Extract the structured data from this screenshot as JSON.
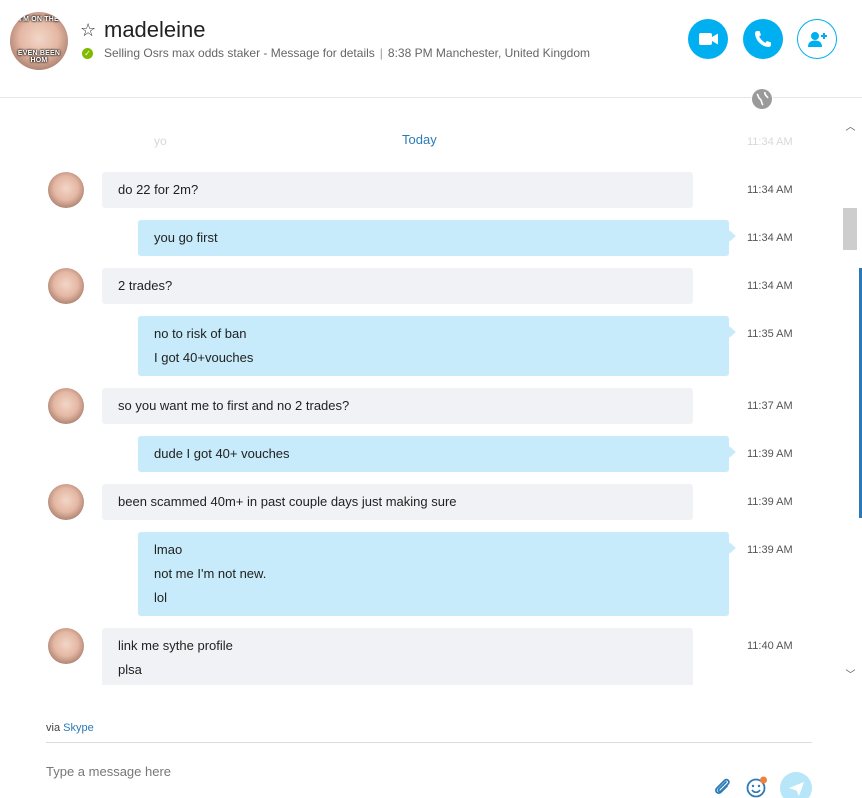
{
  "contact": {
    "name": "madeleine",
    "mood": "Selling Osrs max odds staker - Message for details",
    "local_time": "8:38 PM Manchester, United Kingdom",
    "avatar_caption_top": "I'M ON THE",
    "avatar_caption_bottom": "EVEN BEEN HOM"
  },
  "header": {
    "actions": [
      {
        "name": "video-call",
        "icon": "video-icon"
      },
      {
        "name": "audio-call",
        "icon": "phone-icon"
      },
      {
        "name": "add-people",
        "icon": "add-person-icon"
      }
    ]
  },
  "conversation": {
    "ghost_text": "yo",
    "ghost_time": "11:34 AM",
    "day_label": "Today",
    "messages": [
      {
        "dir": "in",
        "lines": [
          "do 22 for 2m?"
        ],
        "time": "11:34 AM"
      },
      {
        "dir": "out",
        "lines": [
          "you go first"
        ],
        "time": "11:34 AM"
      },
      {
        "dir": "in",
        "lines": [
          "2 trades?"
        ],
        "time": "11:34 AM"
      },
      {
        "dir": "out",
        "lines": [
          "no to risk of ban",
          "I got 40+vouches"
        ],
        "time": "11:35 AM"
      },
      {
        "dir": "in",
        "lines": [
          "so you want me to first and no 2 trades?"
        ],
        "time": "11:37 AM"
      },
      {
        "dir": "out",
        "lines": [
          "dude I got 40+ vouches"
        ],
        "time": "11:39 AM"
      },
      {
        "dir": "in",
        "lines": [
          "been scammed 40m+ in past couple days just making sure"
        ],
        "time": "11:39 AM"
      },
      {
        "dir": "out",
        "lines": [
          "lmao",
          "not me I'm not new.",
          "lol"
        ],
        "time": "11:39 AM"
      },
      {
        "dir": "in",
        "lines": [
          "link me sythe profile",
          "plsa"
        ],
        "time": "11:40 AM"
      }
    ]
  },
  "footer": {
    "via_prefix": "via",
    "via_link": "Skype",
    "compose_placeholder": "Type a message here",
    "icons": [
      "paperclip-icon",
      "emoji-icon",
      "send-icon"
    ]
  },
  "colors": {
    "accent": "#00aff0",
    "incoming_bubble": "#f0f2f5",
    "outgoing_bubble": "#c7ebfa",
    "link": "#2a7ab8",
    "presence_online": "#7fba00"
  }
}
